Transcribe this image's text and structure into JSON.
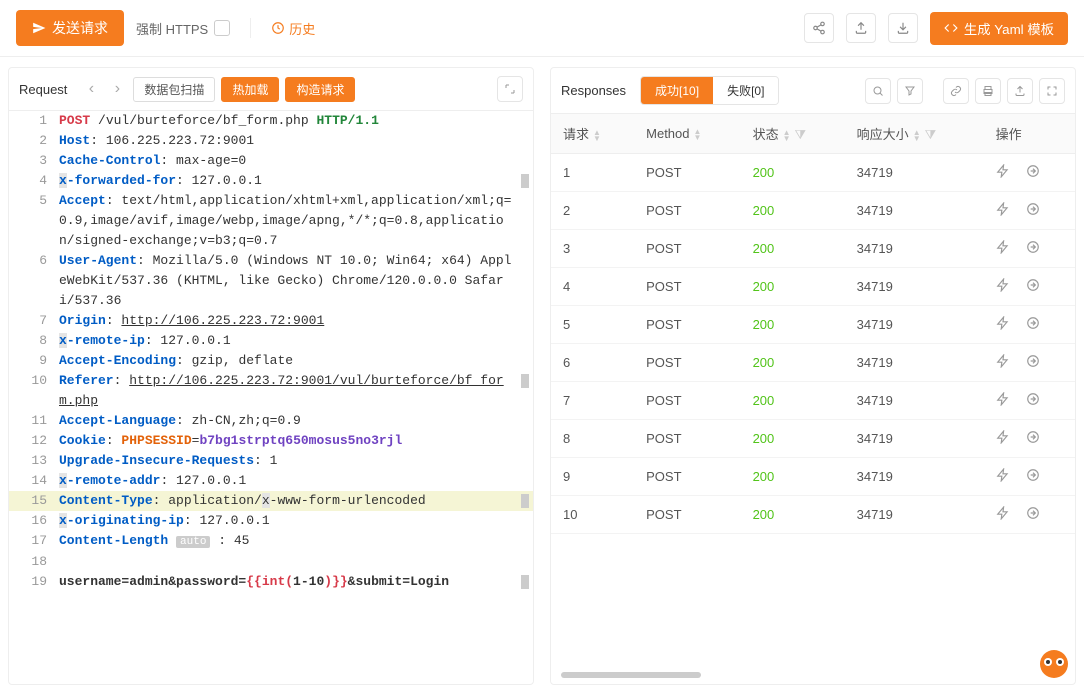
{
  "topbar": {
    "send_label": "发送请求",
    "force_https_label": "强制 HTTPS",
    "history_label": "历史",
    "yaml_label": "生成 Yaml 模板"
  },
  "request_panel": {
    "title": "Request",
    "scan_label": "数据包扫描",
    "hotload_label": "热加载",
    "build_label": "构造请求",
    "editor_lines": [
      {
        "n": 1,
        "segments": [
          {
            "t": "POST",
            "c": "kw-method"
          },
          {
            "t": " /vul/burteforce/bf_form.php "
          },
          {
            "t": "HTTP/1.1",
            "c": "kw-proto"
          }
        ]
      },
      {
        "n": 2,
        "segments": [
          {
            "t": "Host",
            "c": "kw-header"
          },
          {
            "t": ": 106.225.223.72:9001"
          }
        ]
      },
      {
        "n": 3,
        "segments": [
          {
            "t": "Cache-Control",
            "c": "kw-header"
          },
          {
            "t": ": max-age=0"
          }
        ]
      },
      {
        "n": 4,
        "fold": true,
        "segments": [
          {
            "t": "x",
            "c": "kw-header kw-hl"
          },
          {
            "t": "-forwarded-for",
            "c": "kw-header"
          },
          {
            "t": ": 127.0.0.1"
          }
        ]
      },
      {
        "n": 5,
        "segments": [
          {
            "t": "Accept",
            "c": "kw-header"
          },
          {
            "t": ": text/html,application/xhtml+xml,application/xml;q=0.9,image/avif,image/webp,image/apng,*/*;q=0.8,application/signed-exchange;v=b3;q=0.7"
          }
        ]
      },
      {
        "n": 6,
        "segments": [
          {
            "t": "User-Agent",
            "c": "kw-header"
          },
          {
            "t": ": Mozilla/5.0 (Windows NT 10.0; Win64; x64) AppleWebKit/537.36 (KHTML, like Gecko) Chrome/120.0.0.0 Safari/537.36"
          }
        ]
      },
      {
        "n": 7,
        "segments": [
          {
            "t": "Origin",
            "c": "kw-header"
          },
          {
            "t": ": "
          },
          {
            "t": "http://106.225.223.72:9001",
            "c": "kw-link"
          }
        ]
      },
      {
        "n": 8,
        "segments": [
          {
            "t": "x",
            "c": "kw-header kw-hl"
          },
          {
            "t": "-remote-ip",
            "c": "kw-header"
          },
          {
            "t": ": 127.0.0.1"
          }
        ]
      },
      {
        "n": 9,
        "segments": [
          {
            "t": "Accept-Encoding",
            "c": "kw-header"
          },
          {
            "t": ": gzip, deflate"
          }
        ]
      },
      {
        "n": 10,
        "fold": true,
        "segments": [
          {
            "t": "Referer",
            "c": "kw-header"
          },
          {
            "t": ": "
          },
          {
            "t": "http://106.225.223.72:9001/vul/burteforce/bf_form.php",
            "c": "kw-link"
          }
        ]
      },
      {
        "n": 11,
        "segments": [
          {
            "t": "Accept-Language",
            "c": "kw-header"
          },
          {
            "t": ": zh-CN,zh;q=0.9"
          }
        ]
      },
      {
        "n": 12,
        "segments": [
          {
            "t": "Cookie",
            "c": "kw-header"
          },
          {
            "t": ": "
          },
          {
            "t": "PHPSESSID",
            "c": "kw-cookie"
          },
          {
            "t": "="
          },
          {
            "t": "b7bg1strptq650mosus5no3rjl",
            "c": "kw-cookieval"
          }
        ]
      },
      {
        "n": 13,
        "segments": [
          {
            "t": "Upgrade-In",
            "c": "kw-header"
          },
          {
            "t": "secure-Requests",
            "c": "kw-header"
          },
          {
            "t": ": 1"
          }
        ]
      },
      {
        "n": 14,
        "segments": [
          {
            "t": "x",
            "c": "kw-header kw-hl"
          },
          {
            "t": "-remote-addr",
            "c": "kw-header"
          },
          {
            "t": ": 127.0.0.1"
          }
        ]
      },
      {
        "n": 15,
        "hl": true,
        "fold": true,
        "segments": [
          {
            "t": "Content-Type",
            "c": "kw-header"
          },
          {
            "t": ": application/"
          },
          {
            "t": "x",
            "c": "kw-hl"
          },
          {
            "t": "-www-form-urlencoded"
          }
        ]
      },
      {
        "n": 16,
        "segments": [
          {
            "t": "x",
            "c": "kw-header kw-hl"
          },
          {
            "t": "-originating-ip",
            "c": "kw-header"
          },
          {
            "t": ": 127.0.0.1"
          }
        ]
      },
      {
        "n": 17,
        "segments": [
          {
            "t": "Content-Length",
            "c": "kw-header"
          },
          {
            "t": " "
          },
          {
            "t": "auto",
            "c": "kw-auto"
          },
          {
            "t": " : 45"
          }
        ]
      },
      {
        "n": 18,
        "segments": [
          {
            "t": " "
          }
        ]
      },
      {
        "n": 19,
        "fold": true,
        "segments": [
          {
            "t": "username=admin&password=",
            "c": "kw-body"
          },
          {
            "t": "{{int(",
            "c": "kw-template"
          },
          {
            "t": "1-10",
            "c": "kw-body"
          },
          {
            "t": ")}}",
            "c": "kw-template"
          },
          {
            "t": "&submit=Login",
            "c": "kw-body"
          }
        ]
      }
    ]
  },
  "response_panel": {
    "title": "Responses",
    "tab_success": "成功[10]",
    "tab_fail": "失败[0]",
    "columns": {
      "req": "请求",
      "method": "Method",
      "status": "状态",
      "size": "响应大小",
      "actions": "操作"
    },
    "rows": [
      {
        "req": "1",
        "method": "POST",
        "status": "200",
        "size": "34719"
      },
      {
        "req": "2",
        "method": "POST",
        "status": "200",
        "size": "34719"
      },
      {
        "req": "3",
        "method": "POST",
        "status": "200",
        "size": "34719"
      },
      {
        "req": "4",
        "method": "POST",
        "status": "200",
        "size": "34719"
      },
      {
        "req": "5",
        "method": "POST",
        "status": "200",
        "size": "34719"
      },
      {
        "req": "6",
        "method": "POST",
        "status": "200",
        "size": "34719"
      },
      {
        "req": "7",
        "method": "POST",
        "status": "200",
        "size": "34719"
      },
      {
        "req": "8",
        "method": "POST",
        "status": "200",
        "size": "34719"
      },
      {
        "req": "9",
        "method": "POST",
        "status": "200",
        "size": "34719"
      },
      {
        "req": "10",
        "method": "POST",
        "status": "200",
        "size": "34719"
      }
    ]
  }
}
